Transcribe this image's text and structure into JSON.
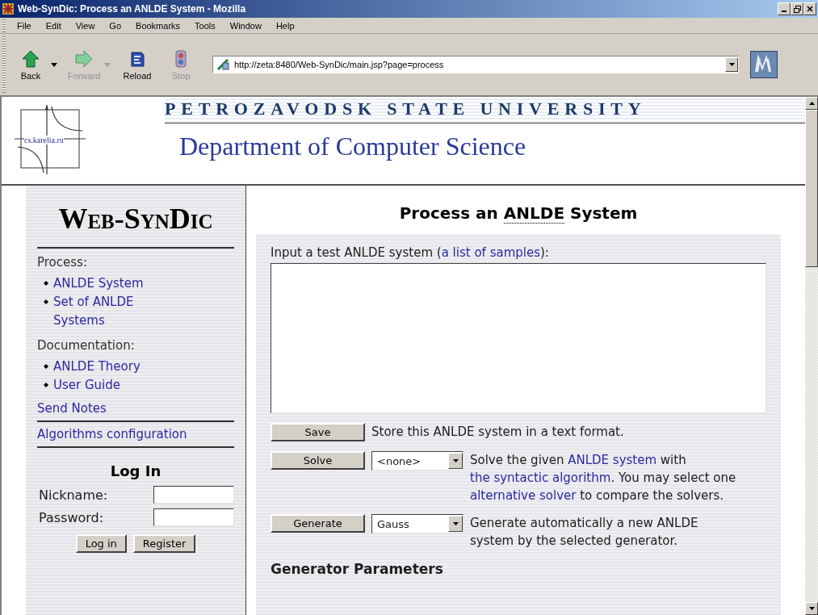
{
  "window": {
    "title": "Web-SynDic: Process an ANLDE System - Mozilla"
  },
  "menu": [
    "File",
    "Edit",
    "View",
    "Go",
    "Bookmarks",
    "Tools",
    "Window",
    "Help"
  ],
  "toolbar": [
    {
      "kind": "back",
      "label": "Back",
      "disabled": false,
      "dropdown": true
    },
    {
      "kind": "forward",
      "label": "Forward",
      "disabled": true,
      "dropdown": true
    },
    {
      "kind": "reload",
      "label": "Reload",
      "disabled": false,
      "dropdown": false
    },
    {
      "kind": "stop",
      "label": "Stop",
      "disabled": true,
      "dropdown": false
    }
  ],
  "address": {
    "value": "http://zeta:8480/Web-SynDic/main.jsp?page=process"
  },
  "header": {
    "logo": "cs.karelia.ru",
    "university": "PETROZAVODSK STATE UNIVERSITY",
    "department": "Department of Computer Science"
  },
  "sidebar": {
    "app_title": "Web-SynDic",
    "sections": [
      {
        "kind": "group",
        "label": "Process:",
        "items": [
          "ANLDE System",
          "Set of ANLDE Systems"
        ]
      },
      {
        "kind": "group",
        "label": "Documentation:",
        "items": [
          "ANLDE Theory",
          "User Guide"
        ]
      },
      {
        "kind": "link",
        "label": "Send Notes"
      },
      {
        "kind": "rule"
      },
      {
        "kind": "link",
        "label": "Algorithms configuration"
      },
      {
        "kind": "rule"
      }
    ],
    "login": {
      "title": "Log In",
      "fields": [
        {
          "label": "Nickname:"
        },
        {
          "label": "Password:"
        }
      ],
      "buttons": [
        "Log in",
        "Register"
      ]
    }
  },
  "main": {
    "heading": [
      {
        "text": "Process an "
      },
      {
        "text": "ANLDE",
        "kind": "abbr"
      },
      {
        "text": " System"
      }
    ],
    "input_label": [
      {
        "text": "Input a test ANLDE system ("
      },
      {
        "text": "a list of samples",
        "kind": "link"
      },
      {
        "text": "):"
      }
    ],
    "actions": [
      {
        "button": "Save",
        "description": [
          {
            "text": "Store this ANLDE system in a text format."
          }
        ]
      },
      {
        "button": "Solve",
        "select": "<none>",
        "description": [
          {
            "text": "Solve the given "
          },
          {
            "text": "ANLDE system",
            "kind": "link"
          },
          {
            "text": " with "
          },
          {
            "text": "the syntactic algorithm",
            "kind": "link"
          },
          {
            "text": ". You may select one "
          },
          {
            "text": "alternative solver",
            "kind": "link"
          },
          {
            "text": " to compare the solvers."
          }
        ]
      },
      {
        "button": "Generate",
        "select": "Gauss",
        "description": [
          {
            "text": "Generate automatically a new ANLDE system by the selected generator."
          }
        ]
      }
    ],
    "section_heading": "Generator Parameters"
  }
}
